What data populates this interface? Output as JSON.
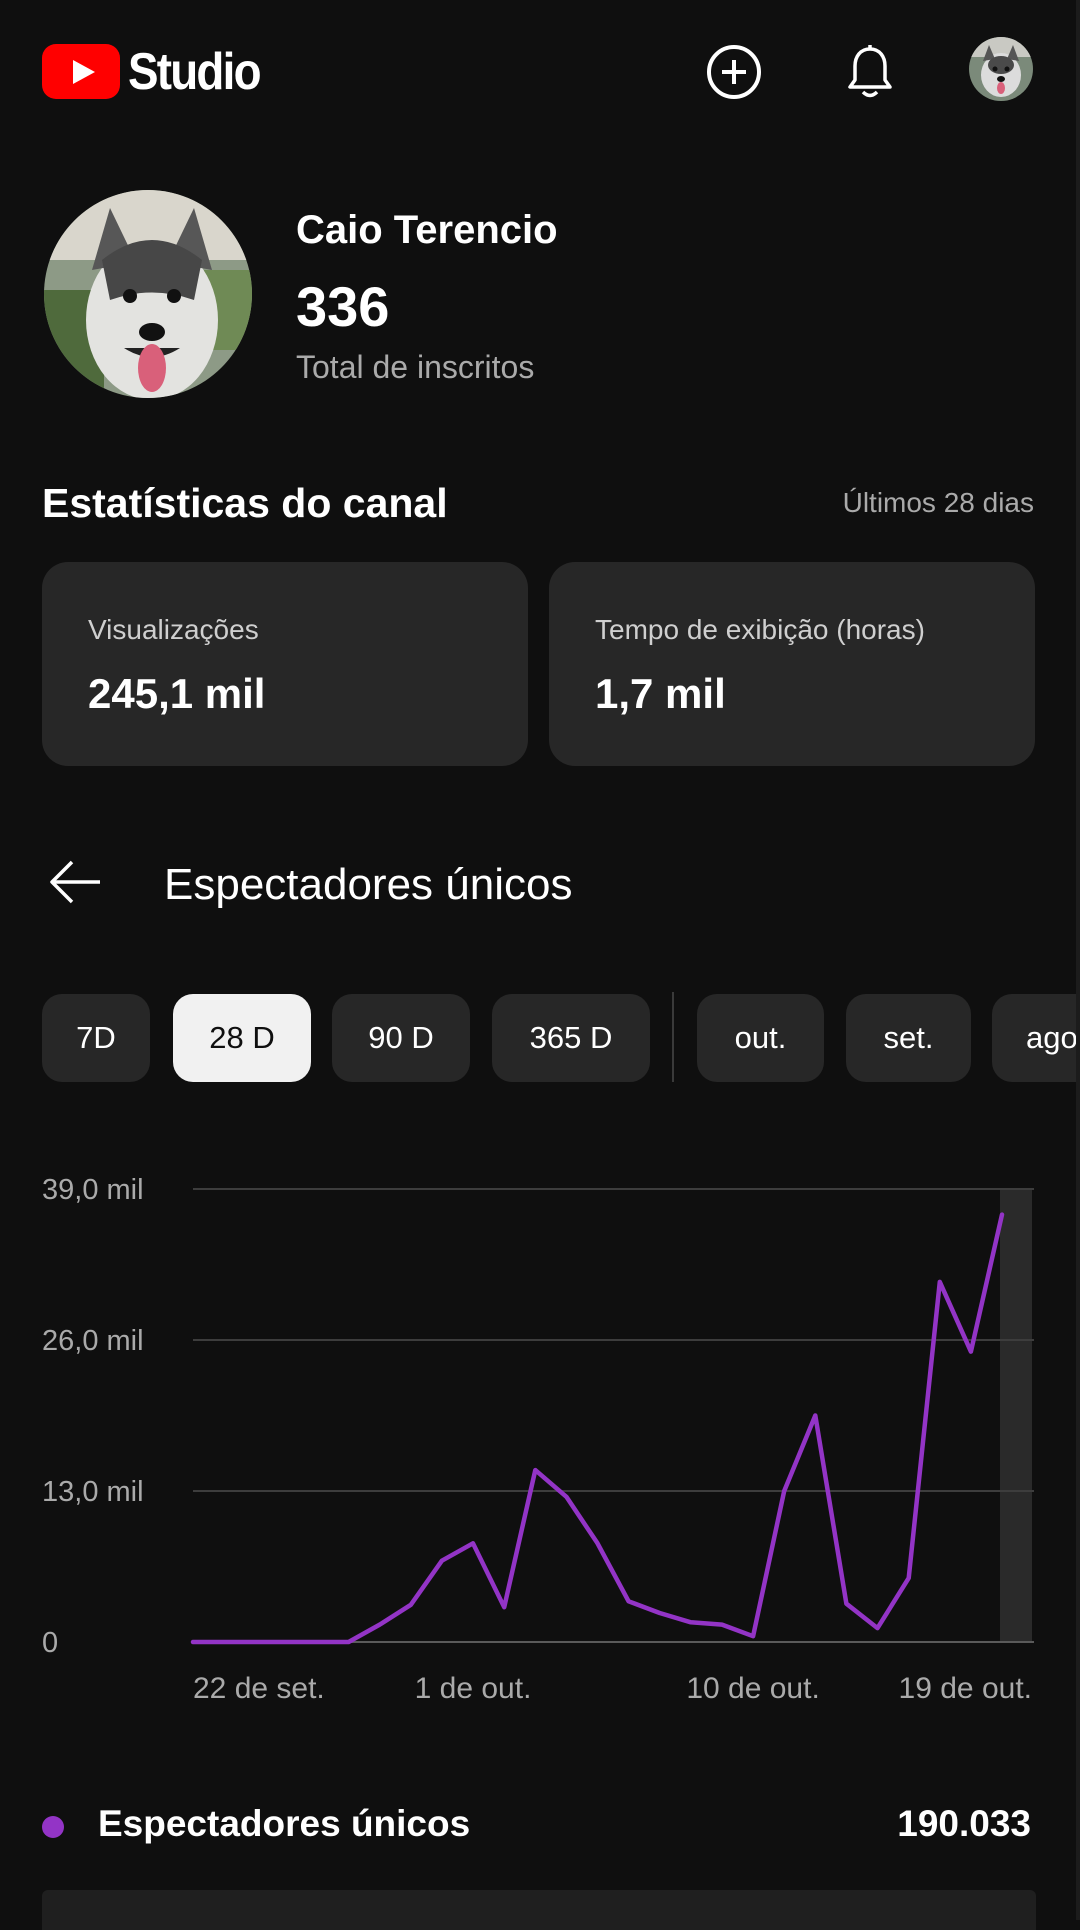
{
  "header": {
    "logo_text": "Studio",
    "icons": [
      "youtube-logo-icon",
      "create-plus-icon",
      "notifications-bell-icon",
      "account-avatar"
    ]
  },
  "channel": {
    "name": "Caio Terencio",
    "subscribers": "336",
    "subscribers_label": "Total de inscritos"
  },
  "stats": {
    "title": "Estatísticas do canal",
    "period": "Últimos 28 dias",
    "cards": [
      {
        "label": "Visualizações",
        "value": "245,1 mil"
      },
      {
        "label": "Tempo de exibição (horas)",
        "value": "1,7 mil"
      }
    ]
  },
  "section": {
    "title": "Espectadores únicos"
  },
  "chips": [
    {
      "label": "7D",
      "selected": false
    },
    {
      "label": "28 D",
      "selected": true
    },
    {
      "label": "90 D",
      "selected": false
    },
    {
      "label": "365 D",
      "selected": false
    },
    {
      "label": "out.",
      "selected": false
    },
    {
      "label": "set.",
      "selected": false
    },
    {
      "label": "ago",
      "selected": false
    }
  ],
  "colors": {
    "background": "#0f0f0f",
    "card": "#272727",
    "accent_line": "#9334c6",
    "brand_red": "#ff0000"
  },
  "chart_data": {
    "type": "line",
    "series": [
      {
        "name": "Espectadores únicos",
        "values": [
          0,
          0,
          0,
          0,
          0,
          0,
          1500,
          3200,
          7000,
          8500,
          3000,
          14800,
          12500,
          8500,
          3500,
          2500,
          1700,
          1500,
          500,
          13000,
          19500,
          3300,
          1200,
          5500,
          31000,
          25000,
          36800
        ]
      }
    ],
    "x_labels": [
      "22 de set.",
      "1 de out.",
      "10 de out.",
      "19 de out."
    ],
    "x_label_indices": [
      0,
      9,
      18,
      26
    ],
    "y_ticks": [
      "0",
      "13,0 mil",
      "26,0 mil",
      "39,0 mil"
    ],
    "ylim": [
      0,
      39000
    ],
    "grid": true,
    "total_label": "Espectadores únicos",
    "total_value": "190.033"
  }
}
